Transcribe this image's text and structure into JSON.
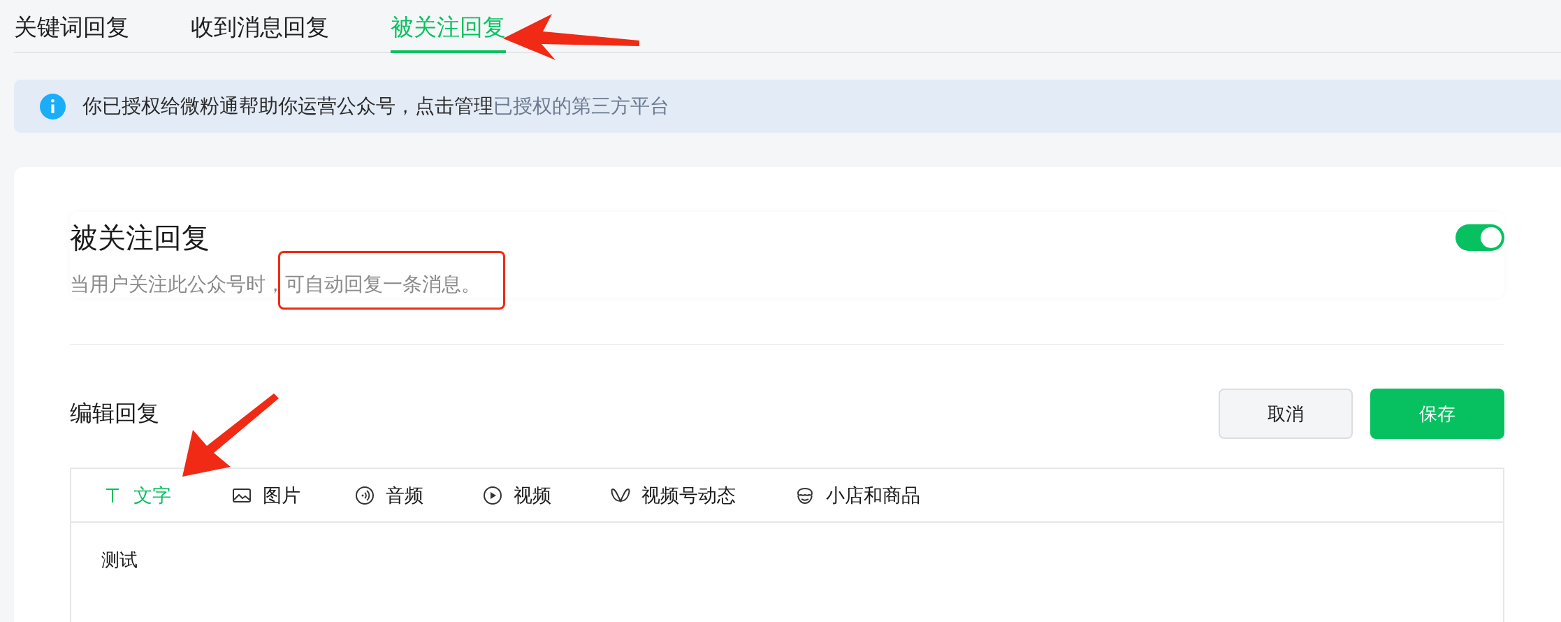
{
  "tabs": [
    {
      "label": "关键词回复",
      "selected": false
    },
    {
      "label": "收到消息回复",
      "selected": false
    },
    {
      "label": "被关注回复",
      "selected": true
    }
  ],
  "notice": {
    "text": "你已授权给微粉通帮助你运营公众号，点击管理",
    "link": "已授权的第三方平台"
  },
  "section": {
    "title": "被关注回复",
    "description": "当用户关注此公众号时，可自动回复一条消息。",
    "on": true
  },
  "editor": {
    "title": "编辑回复",
    "buttons": [
      {
        "label": "取消",
        "kind": "secondary"
      },
      {
        "label": "保存",
        "kind": "primary"
      }
    ],
    "types": [
      {
        "label": "文字",
        "kind": "text",
        "selected": true
      },
      {
        "label": "图片",
        "kind": "image",
        "selected": false
      },
      {
        "label": "音频",
        "kind": "audio",
        "selected": false
      },
      {
        "label": "视频",
        "kind": "video",
        "selected": false
      },
      {
        "label": "视频号动态",
        "kind": "channels",
        "selected": false
      },
      {
        "label": "小店和商品",
        "kind": "shop",
        "selected": false
      }
    ],
    "content": "测试"
  }
}
